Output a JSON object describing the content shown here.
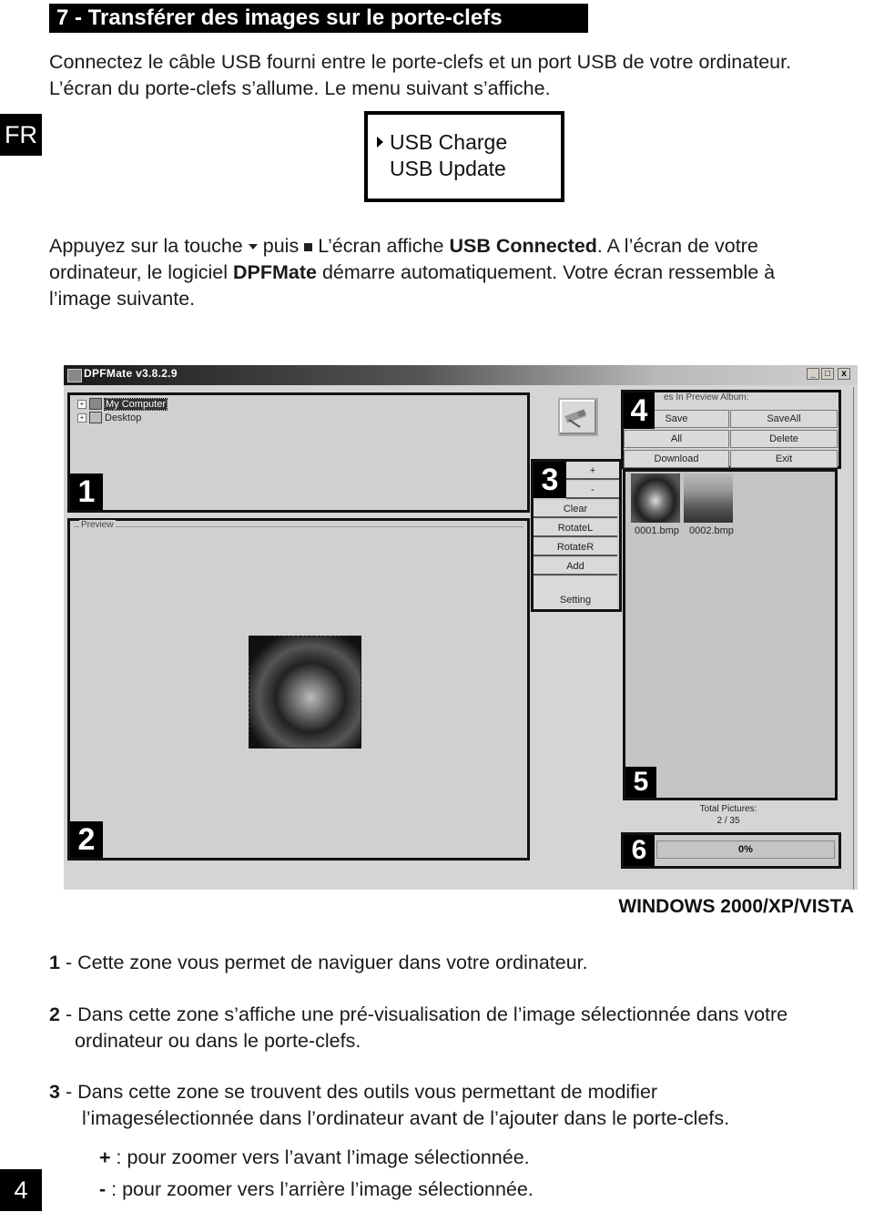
{
  "header": {
    "section_title": "7 - Transférer des images sur le porte-clefs",
    "lang_tab": "FR",
    "page_number": "4"
  },
  "intro": {
    "line1": "Connectez le câble USB fourni entre le porte-clefs et un port USB de votre ordinateur.",
    "line2": "L’écran du porte-clefs s’allume. Le menu suivant s’affiche."
  },
  "lcd_menu": {
    "items": [
      "USB Charge",
      "USB Update"
    ],
    "selected_index": 0
  },
  "instruction": {
    "part1": "Appuyez sur la touche",
    "part2": "puis",
    "part3": "L’écran affiche",
    "bold1": "USB Connected",
    "part4": ". A l’écran de votre",
    "part5": "ordinateur, le logiciel",
    "bold2": "DPFMate",
    "part6": "démarre automatiquement. Votre écran ressemble à",
    "part7": "l’image suivante.",
    "icon_down": "down-arrow-key-icon",
    "icon_stop": "stop-key-icon"
  },
  "app": {
    "title": "DPFMate v3.8.2.9",
    "window_buttons": [
      "_",
      "□",
      "x"
    ],
    "tree": [
      {
        "label": "My Computer",
        "expander": "+",
        "icon": "computer-icon",
        "selected": true
      },
      {
        "label": "Desktop",
        "expander": "+",
        "icon": "desktop-icon",
        "selected": false
      }
    ],
    "preview_label": "Preview",
    "tools": [
      "+",
      "-",
      "Clear",
      "RotateL",
      "RotateR",
      "Add",
      "",
      "Setting"
    ],
    "album_group_label": "es In Preview Album:",
    "album_buttons": [
      "Save",
      "SaveAll",
      "All",
      "Delete",
      "Download",
      "Exit"
    ],
    "thumbnails": [
      "0001.bmp",
      "0002.bmp"
    ],
    "total_label": "Total Pictures:",
    "total_value": "2 / 35",
    "progress_text": "0%",
    "progress": 0,
    "zone_badges": [
      "1",
      "2",
      "3",
      "4",
      "5",
      "6"
    ]
  },
  "os_caption": "WINDOWS 2000/XP/VISTA",
  "descriptions": {
    "d1_num": "1",
    "d1_text": " - Cette zone vous permet de naviguer dans votre ordinateur.",
    "d2_num": "2",
    "d2_text": " - Dans cette zone s’affiche une pré-visualisation de l’image sélectionnée dans votre",
    "d2_cont": "ordinateur ou dans le porte-clefs.",
    "d3_num": "3",
    "d3_text": " - Dans cette zone se trouvent des outils vous permettant de modifier",
    "d3_cont": "l’imagesélectionnée dans l’ordinateur avant de l’ajouter dans le porte-clefs.",
    "plus_sym": "+",
    "plus_text": " : pour zoomer vers l’avant l’image sélectionnée.",
    "minus_sym": "-",
    "minus_text": " : pour zoomer vers l’arrière l’image sélectionnée."
  }
}
